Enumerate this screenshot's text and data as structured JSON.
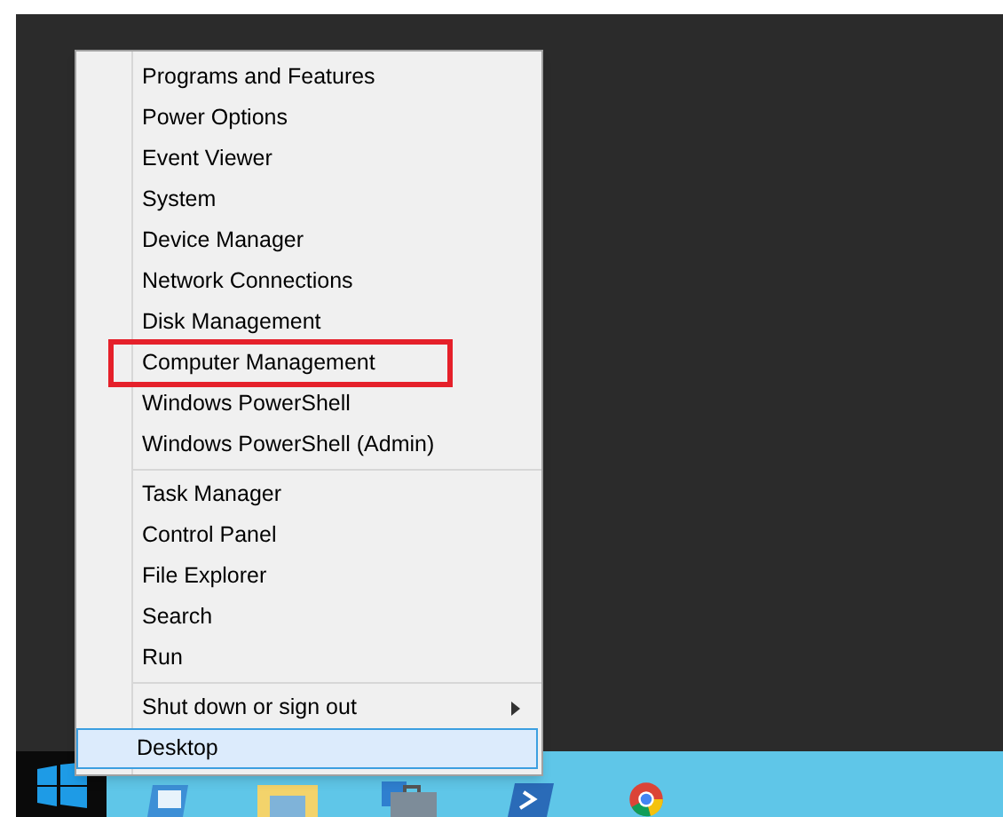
{
  "menu": {
    "sections": [
      {
        "items": [
          {
            "label": "Programs and Features",
            "selected": false,
            "highlighted": false,
            "submenu": false
          },
          {
            "label": "Power Options",
            "selected": false,
            "highlighted": false,
            "submenu": false
          },
          {
            "label": "Event Viewer",
            "selected": false,
            "highlighted": false,
            "submenu": false
          },
          {
            "label": "System",
            "selected": false,
            "highlighted": false,
            "submenu": false
          },
          {
            "label": "Device Manager",
            "selected": false,
            "highlighted": false,
            "submenu": false
          },
          {
            "label": "Network Connections",
            "selected": false,
            "highlighted": false,
            "submenu": false
          },
          {
            "label": "Disk Management",
            "selected": false,
            "highlighted": false,
            "submenu": false
          },
          {
            "label": "Computer Management",
            "selected": false,
            "highlighted": true,
            "submenu": false
          },
          {
            "label": "Windows PowerShell",
            "selected": false,
            "highlighted": false,
            "submenu": false
          },
          {
            "label": "Windows PowerShell (Admin)",
            "selected": false,
            "highlighted": false,
            "submenu": false
          }
        ]
      },
      {
        "items": [
          {
            "label": "Task Manager",
            "selected": false,
            "highlighted": false,
            "submenu": false
          },
          {
            "label": "Control Panel",
            "selected": false,
            "highlighted": false,
            "submenu": false
          },
          {
            "label": "File Explorer",
            "selected": false,
            "highlighted": false,
            "submenu": false
          },
          {
            "label": "Search",
            "selected": false,
            "highlighted": false,
            "submenu": false
          },
          {
            "label": "Run",
            "selected": false,
            "highlighted": false,
            "submenu": false
          }
        ]
      },
      {
        "items": [
          {
            "label": "Shut down or sign out",
            "selected": false,
            "highlighted": false,
            "submenu": true
          },
          {
            "label": "Desktop",
            "selected": true,
            "highlighted": false,
            "submenu": false
          }
        ]
      }
    ]
  },
  "taskbar": {
    "icons": [
      {
        "kind": "server"
      },
      {
        "kind": "folder"
      },
      {
        "kind": "toolbox"
      },
      {
        "kind": "shell"
      },
      {
        "kind": "browser"
      }
    ]
  }
}
